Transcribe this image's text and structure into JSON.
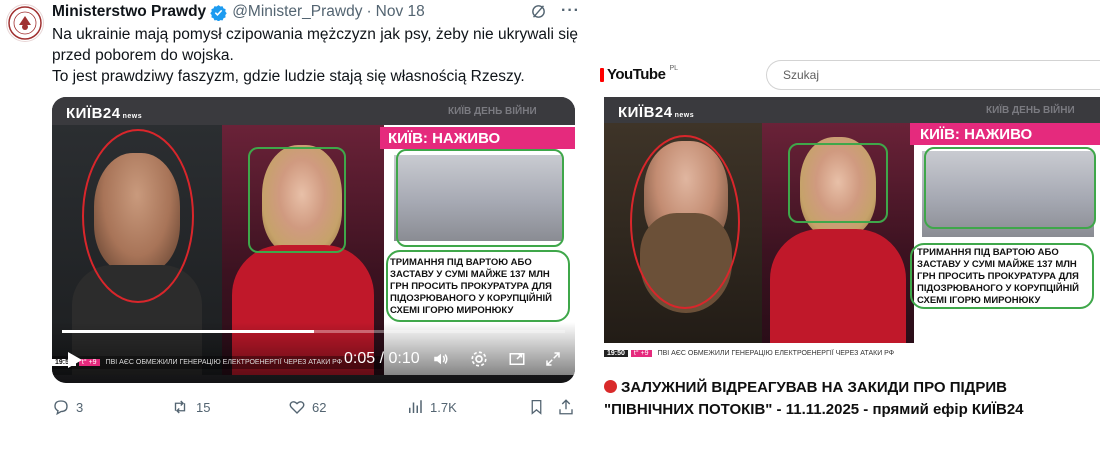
{
  "tweet": {
    "author_name": "Ministerstwo Prawdy",
    "handle": "@Minister_Prawdy",
    "separator": "·",
    "date": "Nov 18",
    "grok_icon": "grok-icon",
    "more_icon": "···",
    "text_line1": "Na ukrainie mają pomysł czipowania mężczyzn jak psy, żeby nie ukrywali się",
    "text_line2": "przed poborem do wojska.",
    "text_line3": "To jest prawdziwy faszyzm, gdzie ludzie stają się własnością Rzeszy.",
    "video": {
      "channel_logo": "КИЇВ24",
      "channel_logo_sub": "news",
      "top_ticker": "КИЇВ ДЕНЬ ВІЙНИ",
      "live_banner": "КИЇВ: НАЖИВО",
      "caption": "ТРИМАННЯ ПІД ВАРТОЮ АБО ЗАСТАВУ У СУМІ МАЙЖЕ 137 МЛН ГРН ПРОСИТЬ ПРОКУРАТУРА ДЛЯ ПІДОЗРЮВАНОГО У КОРУПЦІЙНІЙ СХЕМІ ІГОРЮ МИРОНЮКУ",
      "ticker_time": "19:50",
      "ticker_temp": "t° +9",
      "ticker_text": "ПВІ АЄС ОБМЕЖИЛИ ГЕНЕРАЦІЮ ЕЛЕКТРОЕНЕРГІЇ ЧЕРЕЗ АТАКИ РФ",
      "time_display": "0:05 / 0:10",
      "progress_fraction": 0.5
    },
    "actions": {
      "replies": "3",
      "reposts": "15",
      "likes": "62",
      "views": "1.7K"
    }
  },
  "youtube": {
    "logo_text": "YouTube",
    "region": "PL",
    "search_placeholder": "Szukaj",
    "video": {
      "channel_logo": "КИЇВ24",
      "channel_logo_sub": "news",
      "top_ticker": "КИЇВ ДЕНЬ ВІЙНИ",
      "live_banner": "КИЇВ: НАЖИВО",
      "caption": "ТРИМАННЯ ПІД ВАРТОЮ АБО ЗАСТАВУ У СУМІ МАЙЖЕ 137 МЛН ГРН ПРОСИТЬ ПРОКУРАТУРА ДЛЯ ПІДОЗРЮВАНОГО У КОРУПЦІЙНІЙ СХЕМІ ІГОРЮ МИРОНЮКУ",
      "ticker_time": "19:50",
      "ticker_temp": "t° +9",
      "ticker_text": "ПВІ АЄС ОБМЕЖИЛИ ГЕНЕРАЦІЮ ЕЛЕКТРОЕНЕРГІЇ ЧЕРЕЗ АТАКИ РФ"
    },
    "title_line1": "ЗАЛУЖНИЙ ВІДРЕАГУВАВ НА ЗАКИДИ ПРО ПІДРИВ",
    "title_line2": "\"ПІВНІЧНИХ ПОТОКІВ\" - 11.11.2025 - прямий ефір КИЇВ24"
  },
  "colors": {
    "annotation_red": "#d9262b",
    "annotation_green": "#3fa74a",
    "kyiv24_pink": "#e52a7d",
    "verified_blue": "#1d9bf0",
    "youtube_red": "#ff0000"
  }
}
